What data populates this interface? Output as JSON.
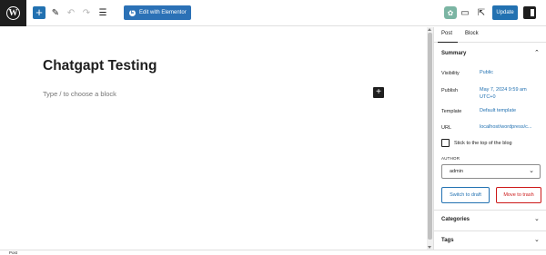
{
  "toolbar": {
    "elementor_label": "Edit with Elementor",
    "update_label": "Update",
    "add_symbol": "+",
    "logo_letter": "W"
  },
  "editor": {
    "title": "Chatgapt Testing",
    "placeholder": "Type / to choose a block"
  },
  "sidebar": {
    "tabs": [
      "Post",
      "Block"
    ],
    "summary": {
      "title": "Summary",
      "visibility_label": "Visibility",
      "visibility_value": "Public",
      "publish_label": "Publish",
      "publish_value_line1": "May 7, 2024 9:59 am",
      "publish_value_line2": "UTC+0",
      "template_label": "Template",
      "template_value": "Default template",
      "url_label": "URL",
      "url_value": "localhost/wordpress/c...",
      "sticky_label": "Stick to the top of the blog",
      "sticky_checked": false,
      "author_label": "AUTHOR",
      "author_value": "admin",
      "switch_draft_label": "Switch to draft",
      "move_trash_label": "Move to trash"
    },
    "categories_title": "Categories",
    "tags_title": "Tags"
  },
  "footer": {
    "label": "Post"
  },
  "colors": {
    "accent": "#2271b1",
    "danger": "#cc1818",
    "dark": "#1e1e1e"
  }
}
